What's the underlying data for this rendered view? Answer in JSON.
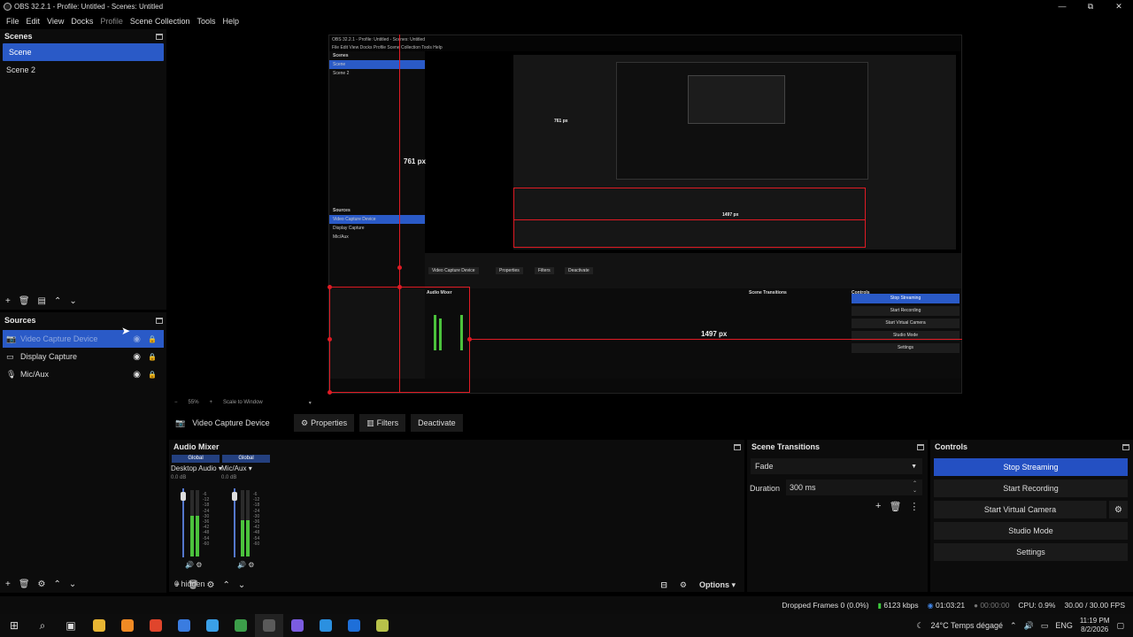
{
  "window": {
    "title": "OBS 32.2.1 - Profile: Untitled - Scenes: Untitled",
    "controls": [
      "—",
      "⧉",
      "✕"
    ]
  },
  "menu": [
    "File",
    "Edit",
    "View",
    "Docks",
    "Profile",
    "Scene Collection",
    "Tools",
    "Help"
  ],
  "scenes": {
    "title": "Scenes",
    "items": [
      "Scene",
      "Scene 2"
    ],
    "selected": 0
  },
  "sources": {
    "title": "Sources",
    "items": [
      {
        "label": "Video Capture Device",
        "icon": "camera-icon"
      },
      {
        "label": "Display Capture",
        "icon": "monitor-icon"
      },
      {
        "label": "Mic/Aux",
        "icon": "microphone-icon"
      }
    ],
    "selected": 0
  },
  "preview": {
    "nested_title": "OBS 32.2.1 - Profile: Untitled - Scenes: Untitled",
    "nested_menu": "File  Edit  View  Docks  Profile  Scene Collection  Tools  Help",
    "nested_scenes_title": "Scenes",
    "nested_scene_items": [
      "Scene",
      "Scene 2"
    ],
    "nested_sources_title": "Sources",
    "nested_source_items": [
      "Video Capture Device",
      "Display Capture",
      "Mic/Aux"
    ],
    "nested_buttons": [
      "Video Capture Device",
      "Properties",
      "Filters",
      "Deactivate"
    ],
    "nested_sections": [
      "Audio Mixer",
      "Scene Transitions",
      "Controls"
    ],
    "nested_controls": [
      "Stop Streaming",
      "Start Recording",
      "Start Virtual Camera",
      "Studio Mode",
      "Settings"
    ],
    "nested_small_labels": [
      "761 px",
      "1497 px"
    ],
    "measure_vertical": "761 px",
    "measure_horizontal": "1497 px"
  },
  "zoom": {
    "minus": "−",
    "value": "55%",
    "plus": "+",
    "mode": "Scale to Window"
  },
  "source_toolbar": {
    "current_source": "Video Capture Device",
    "properties": "Properties",
    "filters": "Filters",
    "deactivate": "Deactivate"
  },
  "mixer": {
    "title": "Audio Mixer",
    "channels": [
      {
        "global": "Global",
        "name": "Desktop Audio",
        "db": "0.0 dB",
        "level": 0.62
      },
      {
        "global": "Global",
        "name": "Mic/Aux",
        "db": "0.0 dB",
        "level": 0.55
      }
    ],
    "scale": [
      "-6",
      "-12",
      "-18",
      "-24",
      "-30",
      "-36",
      "-42",
      "-48",
      "-54",
      "-60"
    ],
    "hidden": "0 hidden",
    "options": "Options"
  },
  "transitions": {
    "title": "Scene Transitions",
    "selected": "Fade",
    "duration_label": "Duration",
    "duration_value": "300 ms"
  },
  "controls": {
    "title": "Controls",
    "stop_streaming": "Stop Streaming",
    "start_recording": "Start Recording",
    "start_virtual_camera": "Start Virtual Camera",
    "studio_mode": "Studio Mode",
    "settings": "Settings"
  },
  "status": {
    "dropped_frames": "Dropped Frames 0 (0.0%)",
    "bitrate": "6123 kbps",
    "stream_time": "01:03:21",
    "record_time": "00:00:00",
    "cpu": "CPU: 0.9%",
    "fps": "30.00 / 30.00 FPS"
  },
  "taskbar": {
    "weather": "24°C  Temps dégagé",
    "lang": "ENG",
    "time": "11:19 PM",
    "date": "8/2/2026",
    "app_colors": [
      "#e8b533",
      "#f08a24",
      "#e0452c",
      "#3a7ce0",
      "#3aa0e8",
      "#3c9e4a",
      "#5a5a5a",
      "#7b5ce0",
      "#2b90e0",
      "#1e6fd9",
      "#b8c24a"
    ]
  },
  "colors": {
    "accent": "#2a5ac7",
    "primary_button": "#2450c2",
    "measure_red": "#e01b24",
    "meter_green": "#4bc23c"
  }
}
